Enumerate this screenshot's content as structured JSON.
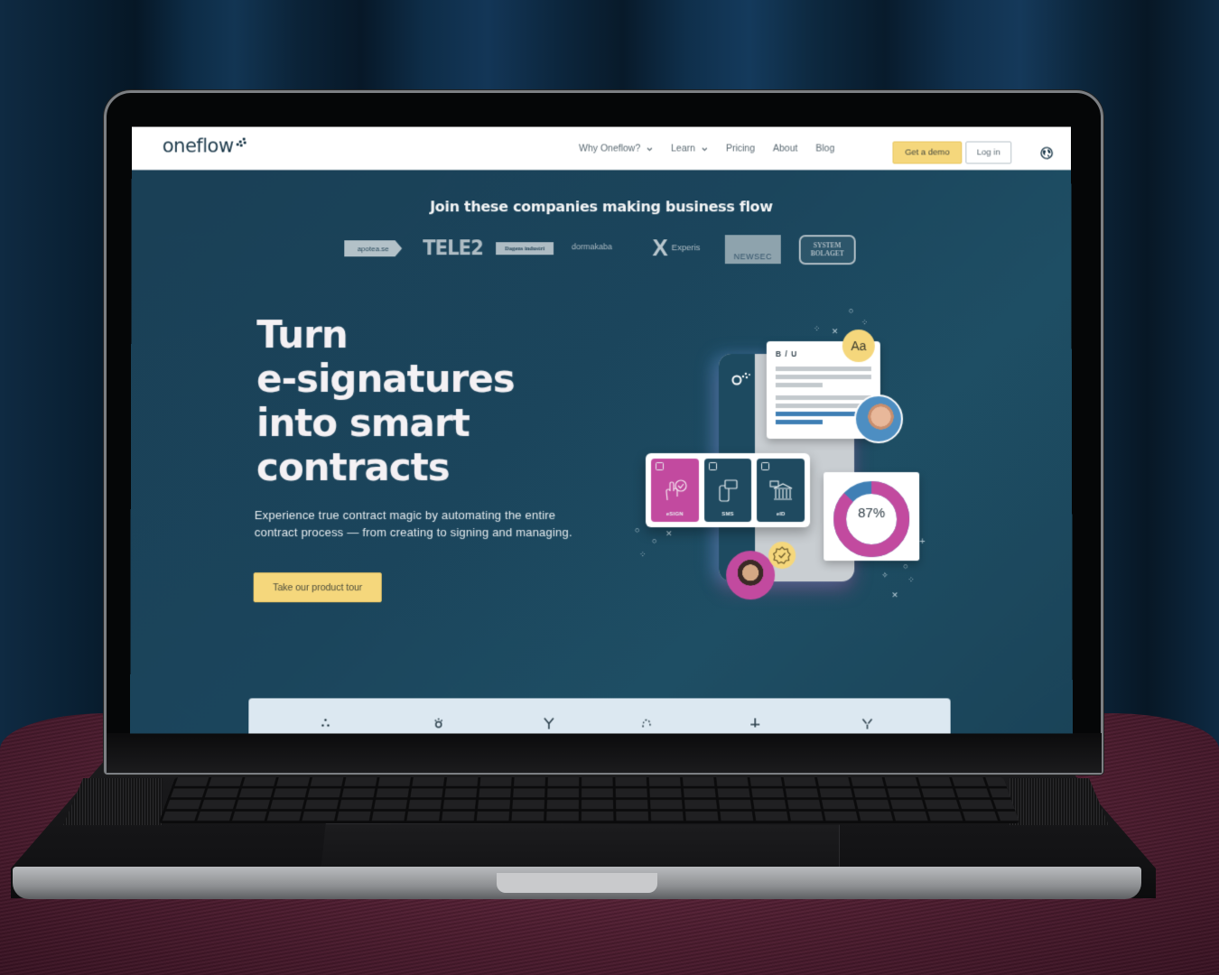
{
  "nav": {
    "logo": "oneflow",
    "links": [
      {
        "label": "Why Oneflow?",
        "has_dropdown": true
      },
      {
        "label": "Learn",
        "has_dropdown": true
      },
      {
        "label": "Pricing",
        "has_dropdown": false
      },
      {
        "label": "About",
        "has_dropdown": false
      },
      {
        "label": "Blog",
        "has_dropdown": false
      }
    ],
    "demo_button": "Get a demo",
    "login_button": "Log in",
    "language_icon": "globe-icon"
  },
  "logos_section": {
    "title": "Join these companies making business flow",
    "companies": [
      "apotea.se",
      "TELE2",
      "Dagens industri",
      "dormakaba",
      "Experis",
      "NEWSEC",
      "SYSTEM BOLAGET"
    ],
    "experis_mark": "X",
    "systembolaget_lines": [
      "SYSTEM",
      "BOLAGET"
    ]
  },
  "hero": {
    "title_lines": [
      "Turn",
      "e-signatures",
      "into smart",
      "contracts"
    ],
    "subtitle": "Experience true contract magic by automating the entire contract process — from creating to signing and managing.",
    "cta_button": "Take our product tour"
  },
  "illustration": {
    "doc_toolbar": "B / U",
    "font_badge": "Aa",
    "sign_options": [
      {
        "label": "eSIGN",
        "active": true,
        "checked": true
      },
      {
        "label": "SMS",
        "active": false,
        "checked": true
      },
      {
        "label": "eID",
        "active": false,
        "checked": true
      }
    ],
    "donut_percent": 87,
    "donut_label": "87%",
    "colors": {
      "magenta": "#c24a9f",
      "blue": "#3f7fb5",
      "yellow": "#f5d77c",
      "teal": "#1f4a60"
    }
  },
  "theme": {
    "page_bg": "#1b455c",
    "accent_yellow": "#f5d77c",
    "nav_text": "#5b6a73"
  }
}
